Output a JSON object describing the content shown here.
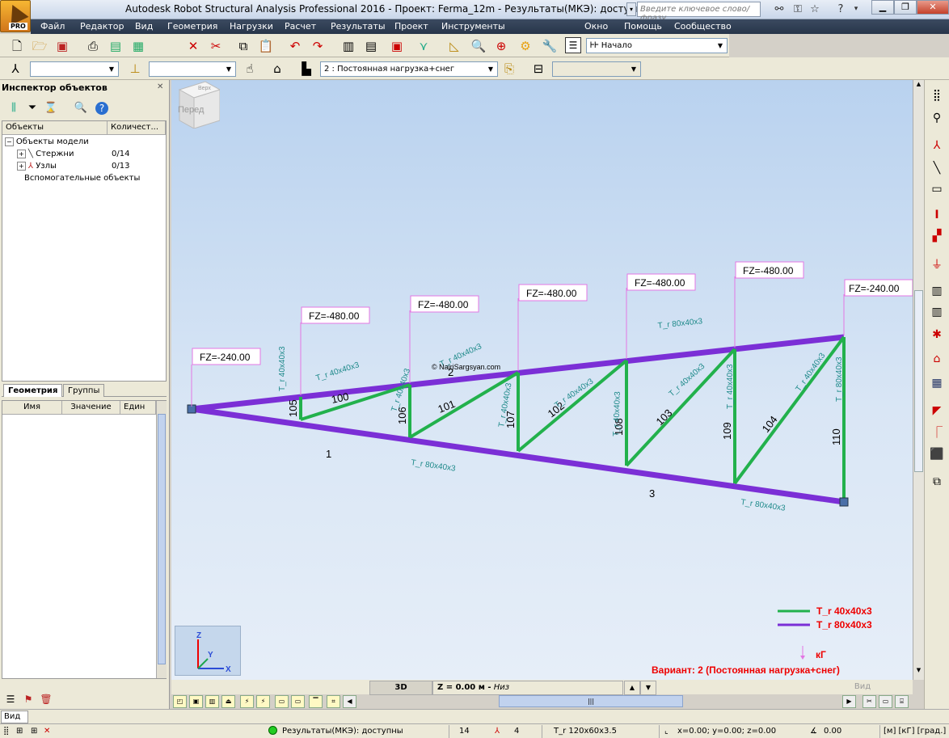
{
  "window": {
    "title": "Autodesk Robot Structural Analysis Professional 2016 - Проект: Ferma_12m - Результаты(МКЭ): доступны",
    "logo_badge": "PRO",
    "search_placeholder": "Введите ключевое слово/фразу"
  },
  "menu": [
    "Файл",
    "Редактор",
    "Вид",
    "Геометрия",
    "Нагрузки",
    "Расчет",
    "Результаты",
    "Проект",
    "Инструменты",
    "Окно",
    "Помощь",
    "Сообщество"
  ],
  "toolbar": {
    "layout_combo": "Начало",
    "layout_icon": "ᎰᎰ",
    "case_combo": "2 : Постоянная нагрузка+снег"
  },
  "inspector": {
    "title": "Инспектор объектов",
    "col_objects": "Объекты",
    "col_count": "Количест...",
    "root": "Объекты модели",
    "items": [
      {
        "label": "Стержни",
        "count": "0/14"
      },
      {
        "label": "Узлы",
        "count": "0/13"
      }
    ],
    "aux": "Вспомогательные объекты",
    "tabs": [
      "Геометрия",
      "Группы"
    ],
    "prop_cols": [
      "Имя",
      "Значение",
      "Един"
    ]
  },
  "model": {
    "loads": [
      {
        "label": "FZ=-240.00"
      },
      {
        "label": "FZ=-480.00"
      },
      {
        "label": "FZ=-480.00"
      },
      {
        "label": "FZ=-480.00"
      },
      {
        "label": "FZ=-480.00"
      },
      {
        "label": "FZ=-480.00"
      },
      {
        "label": "FZ=-240.00"
      }
    ],
    "member_numbers": [
      "105",
      "100",
      "106",
      "101",
      "107",
      "102",
      "108",
      "103",
      "109",
      "104",
      "110",
      "1",
      "3",
      "2"
    ],
    "section_labels": [
      "T_r 40x40x3",
      "T_r 40x40x3",
      "T_r 40x40x3",
      "T_r 40x40x3",
      "T_r 40x40x3",
      "T_r 40x40x3",
      "T_r 40x40x3",
      "T_r 40x40x3",
      "T_r 40x40x3",
      "T_r 40x40x3",
      "T_r 80x40x3",
      "T_r 80x40x3",
      "T_r 80x40x3",
      "T_r 80x40x3"
    ],
    "watermark": "© NairiSargsyan.com",
    "cube_face": "Перед",
    "cube_top": "Верх"
  },
  "legend": {
    "items": [
      {
        "label": "T_r 40x40x3",
        "color": "#22b14c"
      },
      {
        "label": "T_r 80x40x3",
        "color": "#7b2fd6"
      }
    ],
    "unit": "кГ",
    "case": "Вариант: 2 (Постоянная нагрузка+снег)"
  },
  "axes": {
    "x": "X",
    "y": "Y",
    "z": "Z"
  },
  "view_bar": {
    "mode": "3D",
    "plane": "Z = 0.00 м -",
    "plane_italic": "Низ",
    "view": "Вид"
  },
  "command": {
    "value": "Вид"
  },
  "status": {
    "results": "Результаты(МКЭ): доступны",
    "n1": "14",
    "n2": "4",
    "section": "T_r 120x60x3.5",
    "coords": "x=0.00; y=0.00; z=0.00",
    "angle": "0.00",
    "units": "[м] [кГ] [град.]"
  },
  "colors": {
    "web": "#22b14c",
    "chord": "#7b2fd6",
    "load": "#e377e3",
    "label": "#1f8a8a"
  }
}
